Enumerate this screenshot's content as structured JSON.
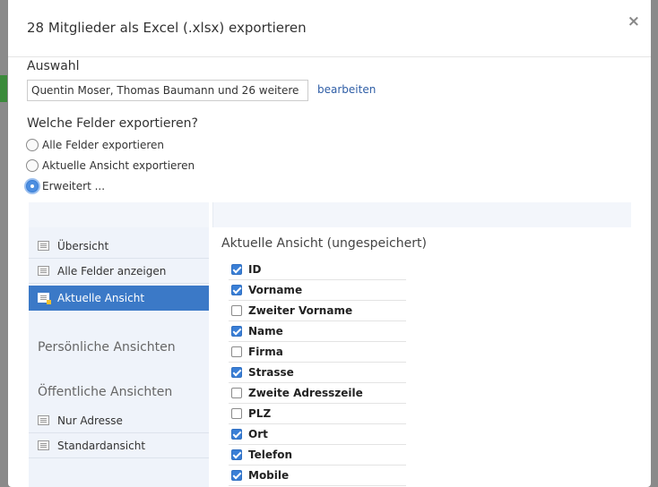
{
  "dialog": {
    "title": "28 Mitglieder als Excel (.xlsx) exportieren",
    "close_label": "×"
  },
  "selection": {
    "label": "Auswahl",
    "value": "Quentin Moser, Thomas Baumann und 26 weitere",
    "edit_link": "bearbeiten"
  },
  "fields_question": "Welche Felder exportieren?",
  "export_options": [
    {
      "label": "Alle Felder exportieren",
      "checked": false
    },
    {
      "label": "Aktuelle Ansicht exportieren",
      "checked": false
    },
    {
      "label": "Erweitert ...",
      "checked": true
    }
  ],
  "sidebar": {
    "items": [
      {
        "label": "Übersicht",
        "active": false
      },
      {
        "label": "Alle Felder anzeigen",
        "active": false
      },
      {
        "label": "Aktuelle Ansicht",
        "active": true
      }
    ],
    "personal_heading": "Persönliche Ansichten",
    "public_heading": "Öffentliche Ansichten",
    "public_items": [
      {
        "label": "Nur Adresse"
      },
      {
        "label": "Standardansicht"
      }
    ]
  },
  "main": {
    "title": "Aktuelle Ansicht (ungespeichert)",
    "fields": [
      {
        "label": "ID",
        "checked": true
      },
      {
        "label": "Vorname",
        "checked": true
      },
      {
        "label": "Zweiter Vorname",
        "checked": false
      },
      {
        "label": "Name",
        "checked": true
      },
      {
        "label": "Firma",
        "checked": false
      },
      {
        "label": "Strasse",
        "checked": true
      },
      {
        "label": "Zweite Adresszeile",
        "checked": false
      },
      {
        "label": "PLZ",
        "checked": false
      },
      {
        "label": "Ort",
        "checked": true
      },
      {
        "label": "Telefon",
        "checked": true
      },
      {
        "label": "Mobile",
        "checked": true
      }
    ]
  },
  "colors": {
    "accent": "#3b79c7",
    "link": "#2f5ea6"
  }
}
